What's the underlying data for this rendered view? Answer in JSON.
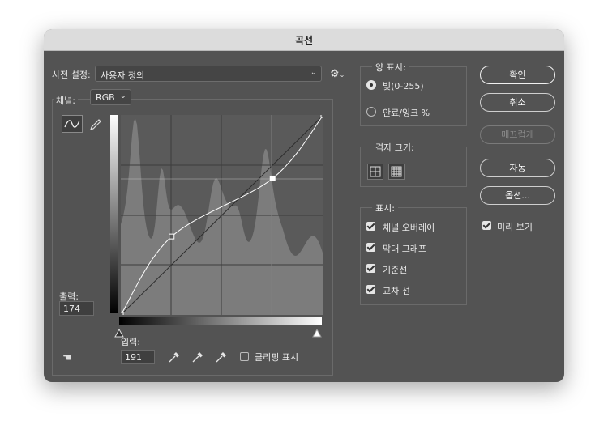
{
  "window": {
    "title": "곡선"
  },
  "preset": {
    "label": "사전 설정:",
    "value": "사용자 정의"
  },
  "channel": {
    "label": "채널:",
    "value": "RGB"
  },
  "output": {
    "label": "출력:",
    "value": "174"
  },
  "input": {
    "label": "입력:",
    "value": "191"
  },
  "clipping": {
    "label": "클리핑 표시",
    "checked": false
  },
  "show_amount": {
    "legend": "양 표시:",
    "options": [
      {
        "label": "빛(0-255)",
        "selected": true
      },
      {
        "label": "안료/잉크 %",
        "selected": false
      }
    ]
  },
  "grid_size": {
    "legend": "격자 크기:"
  },
  "display": {
    "legend": "표시:",
    "options": [
      {
        "label": "채널 오버레이",
        "checked": true
      },
      {
        "label": "막대 그래프",
        "checked": true
      },
      {
        "label": "기준선",
        "checked": true
      },
      {
        "label": "교차 선",
        "checked": true
      }
    ]
  },
  "buttons": {
    "ok": "확인",
    "cancel": "취소",
    "smooth": "매끄럽게",
    "auto": "자동",
    "options": "옵션..."
  },
  "preview": {
    "label": "미리 보기",
    "checked": true
  },
  "curve": {
    "points": [
      [
        0,
        0
      ],
      [
        64,
        100
      ],
      [
        191,
        174
      ],
      [
        255,
        255
      ]
    ],
    "colors": {
      "graph_bg": "#5a5a5a",
      "histogram": "#7c7c7c"
    }
  }
}
